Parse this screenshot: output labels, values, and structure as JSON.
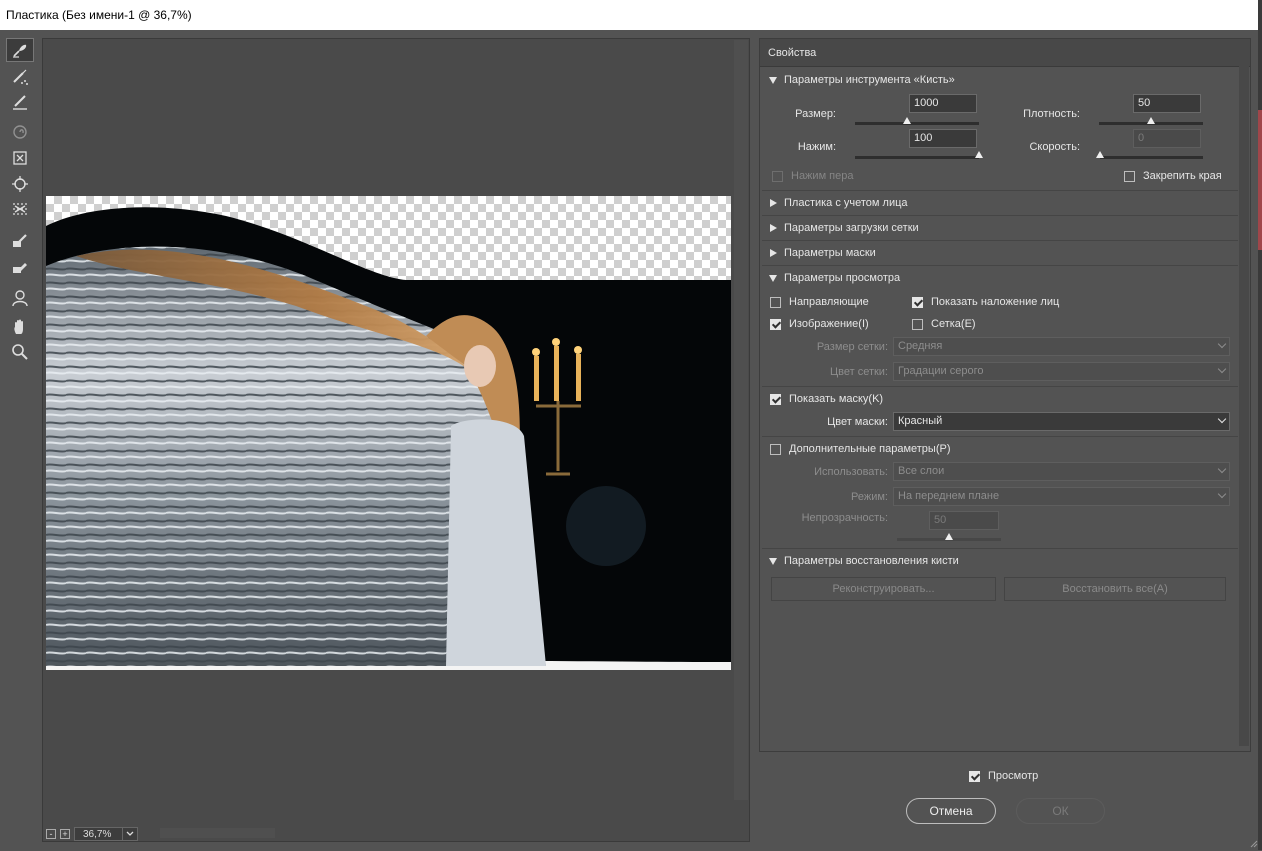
{
  "window": {
    "title": "Пластика (Без имени-1 @ 36,7%)"
  },
  "tools": [
    {
      "name": "forward-warp-tool-icon",
      "active": true
    },
    {
      "name": "reconstruct-tool-icon"
    },
    {
      "name": "smooth-tool-icon"
    },
    {
      "name": "twirl-clockwise-tool-icon",
      "disabled": true
    },
    {
      "name": "pucker-tool-icon"
    },
    {
      "name": "bloat-tool-icon"
    },
    {
      "name": "push-left-tool-icon"
    },
    {
      "name": "freeze-mask-tool-icon"
    },
    {
      "name": "thaw-mask-tool-icon"
    },
    {
      "name": "face-tool-icon"
    },
    {
      "name": "hand-tool-icon"
    },
    {
      "name": "zoom-tool-icon"
    }
  ],
  "zoom": {
    "minus": "-",
    "plus": "+",
    "value": "36,7%"
  },
  "panel": {
    "title": "Свойства",
    "brush": {
      "header": "Параметры инструмента «Кисть»",
      "size_label": "Размер:",
      "size_value": "1000",
      "size_level": 0.42,
      "density_label": "Плотность:",
      "density_value": "50",
      "density_level": 0.5,
      "pressure_label": "Нажим:",
      "pressure_value": "100",
      "pressure_level": 1.0,
      "rate_label": "Скорость:",
      "rate_value": "0",
      "rate_level": 0.0,
      "stylus_label": "Нажим пера",
      "pin_edges_label": "Закрепить края"
    },
    "sections": {
      "face": "Пластика с учетом лица",
      "mesh": "Параметры загрузки сетки",
      "mask": "Параметры маски",
      "view": "Параметры просмотра",
      "restore": "Параметры восстановления кисти"
    },
    "view": {
      "guides": "Направляющие",
      "face_overlay": "Показать наложение лиц",
      "image": "Изображение(I)",
      "mesh": "Сетка(E)",
      "mesh_size_label": "Размер сетки:",
      "mesh_size_value": "Средняя",
      "mesh_color_label": "Цвет сетки:",
      "mesh_color_value": "Градации серого",
      "show_mask": "Показать маску(K)",
      "mask_color_label": "Цвет маски:",
      "mask_color_value": "Красный",
      "extra": "Дополнительные параметры(P)",
      "use_label": "Использовать:",
      "use_value": "Все слои",
      "mode_label": "Режим:",
      "mode_value": "На переднем плане",
      "opacity_label": "Непрозрачность:",
      "opacity_value": "50",
      "opacity_level": 0.5
    },
    "restore": {
      "reconstruct": "Реконструировать...",
      "restore_all": "Восстановить все(A)"
    }
  },
  "footer": {
    "preview": "Просмотр",
    "cancel": "Отмена",
    "ok": "ОК"
  }
}
